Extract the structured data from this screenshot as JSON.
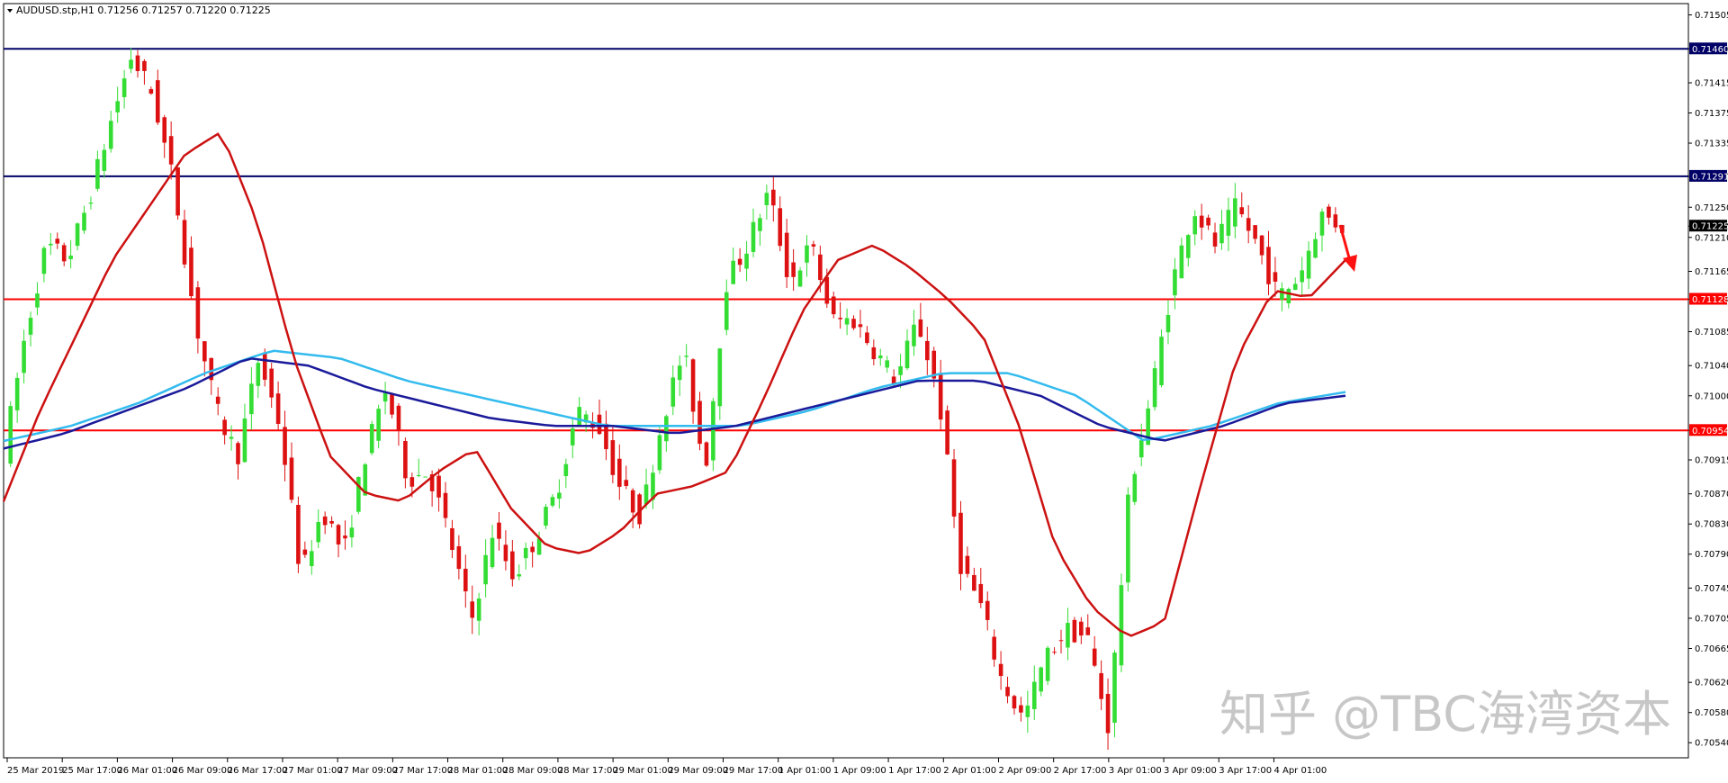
{
  "header": {
    "symbol_text": "AUDUSD.stp,H1  0.71256 0.71257 0.71220 0.71225"
  },
  "watermark": {
    "text": "知乎 @TBC海湾资本"
  },
  "colors": {
    "background": "#ffffff",
    "bull_candle": "#33dd33",
    "bear_candle": "#dd1111",
    "support_resistance_red": "#ff0000",
    "resistance_navy": "#000066",
    "ma_fast": "#cc1111",
    "ma_slow_dark": "#1a1a9a",
    "ma_slow_light": "#33bbee",
    "current_price_box": "#000000",
    "arrow": "#ff1111"
  },
  "chart_data": {
    "type": "candlestick",
    "title": "AUDUSD.stp,H1",
    "ylim": [
      0.7052,
      0.7152
    ],
    "y_ticks": [
      "0.71505",
      "0.71460",
      "0.71415",
      "0.71375",
      "0.71335",
      "0.71291",
      "0.71250",
      "0.71225",
      "0.71210",
      "0.71165",
      "0.71128",
      "0.71085",
      "0.71040",
      "0.71000",
      "0.70954",
      "0.70915",
      "0.70870",
      "0.70830",
      "0.70790",
      "0.70745",
      "0.70705",
      "0.70665",
      "0.70620",
      "0.70580",
      "0.70540"
    ],
    "x_ticks": [
      "25 Mar 2019",
      "25 Mar 17:00",
      "26 Mar 01:00",
      "26 Mar 09:00",
      "26 Mar 17:00",
      "27 Mar 01:00",
      "27 Mar 09:00",
      "27 Mar 17:00",
      "28 Mar 01:00",
      "28 Mar 09:00",
      "28 Mar 17:00",
      "29 Mar 01:00",
      "29 Mar 09:00",
      "29 Mar 17:00",
      "1 Apr 01:00",
      "1 Apr 09:00",
      "1 Apr 17:00",
      "2 Apr 01:00",
      "2 Apr 09:00",
      "2 Apr 17:00",
      "3 Apr 01:00",
      "3 Apr 09:00",
      "3 Apr 17:00",
      "4 Apr 01:00"
    ],
    "candle_count": 200,
    "price_path": [
      0.70925,
      0.7108,
      0.712,
      0.7118,
      0.7126,
      0.7136,
      0.7145,
      0.714,
      0.7128,
      0.711,
      0.7098,
      0.7092,
      0.7105,
      0.7096,
      0.7076,
      0.7085,
      0.7079,
      0.7092,
      0.7101,
      0.7089,
      0.709,
      0.7081,
      0.707,
      0.7082,
      0.7076,
      0.7081,
      0.7087,
      0.7098,
      0.7096,
      0.7088,
      0.7084,
      0.7097,
      0.7106,
      0.709,
      0.7115,
      0.712,
      0.7127,
      0.7115,
      0.712,
      0.711,
      0.711,
      0.7106,
      0.7102,
      0.711,
      0.71,
      0.7078,
      0.7072,
      0.7062,
      0.7057,
      0.7065,
      0.7069,
      0.7068,
      0.7056,
      0.7088,
      0.71,
      0.7115,
      0.7125,
      0.712,
      0.7125,
      0.712,
      0.7113,
      0.7116,
      0.7124,
      0.71225
    ],
    "horizontal_levels": [
      {
        "label": "0.71460",
        "value": 0.7146,
        "color": "#000066"
      },
      {
        "label": "0.71291",
        "value": 0.71291,
        "color": "#000066"
      },
      {
        "label": "0.71128",
        "value": 0.71128,
        "color": "#ff0000"
      },
      {
        "label": "0.70954",
        "value": 0.70954,
        "color": "#ff0000"
      }
    ],
    "current_price": {
      "label": "0.71225",
      "value": 0.71225
    },
    "ma_fast_path": [
      0.7086,
      0.7098,
      0.7108,
      0.7118,
      0.7125,
      0.7132,
      0.7135,
      0.7123,
      0.7105,
      0.7092,
      0.7087,
      0.7086,
      0.709,
      0.7093,
      0.7085,
      0.708,
      0.7079,
      0.7082,
      0.7087,
      0.7088,
      0.709,
      0.71,
      0.7111,
      0.7118,
      0.712,
      0.7117,
      0.7113,
      0.7108,
      0.7096,
      0.708,
      0.7072,
      0.7068,
      0.707,
      0.7088,
      0.7105,
      0.7114,
      0.7113,
      0.7118
    ],
    "ma_slow_dark_path": [
      0.7093,
      0.7095,
      0.7098,
      0.7101,
      0.7105,
      0.7104,
      0.7101,
      0.7099,
      0.7097,
      0.7096,
      0.7096,
      0.7095,
      0.7096,
      0.7098,
      0.71,
      0.7102,
      0.7102,
      0.71,
      0.7096,
      0.7094,
      0.7096,
      0.7099,
      0.71
    ],
    "ma_slow_light_path": [
      0.7094,
      0.7096,
      0.7099,
      0.7103,
      0.7106,
      0.7105,
      0.7102,
      0.71,
      0.7098,
      0.7096,
      0.7096,
      0.7096,
      0.7098,
      0.7101,
      0.7103,
      0.7103,
      0.71,
      0.7094,
      0.7096,
      0.7099,
      0.71005
    ],
    "legend": "none",
    "grid": false,
    "annotation": {
      "type": "arrow",
      "direction": "down",
      "color": "#ff1111"
    }
  }
}
